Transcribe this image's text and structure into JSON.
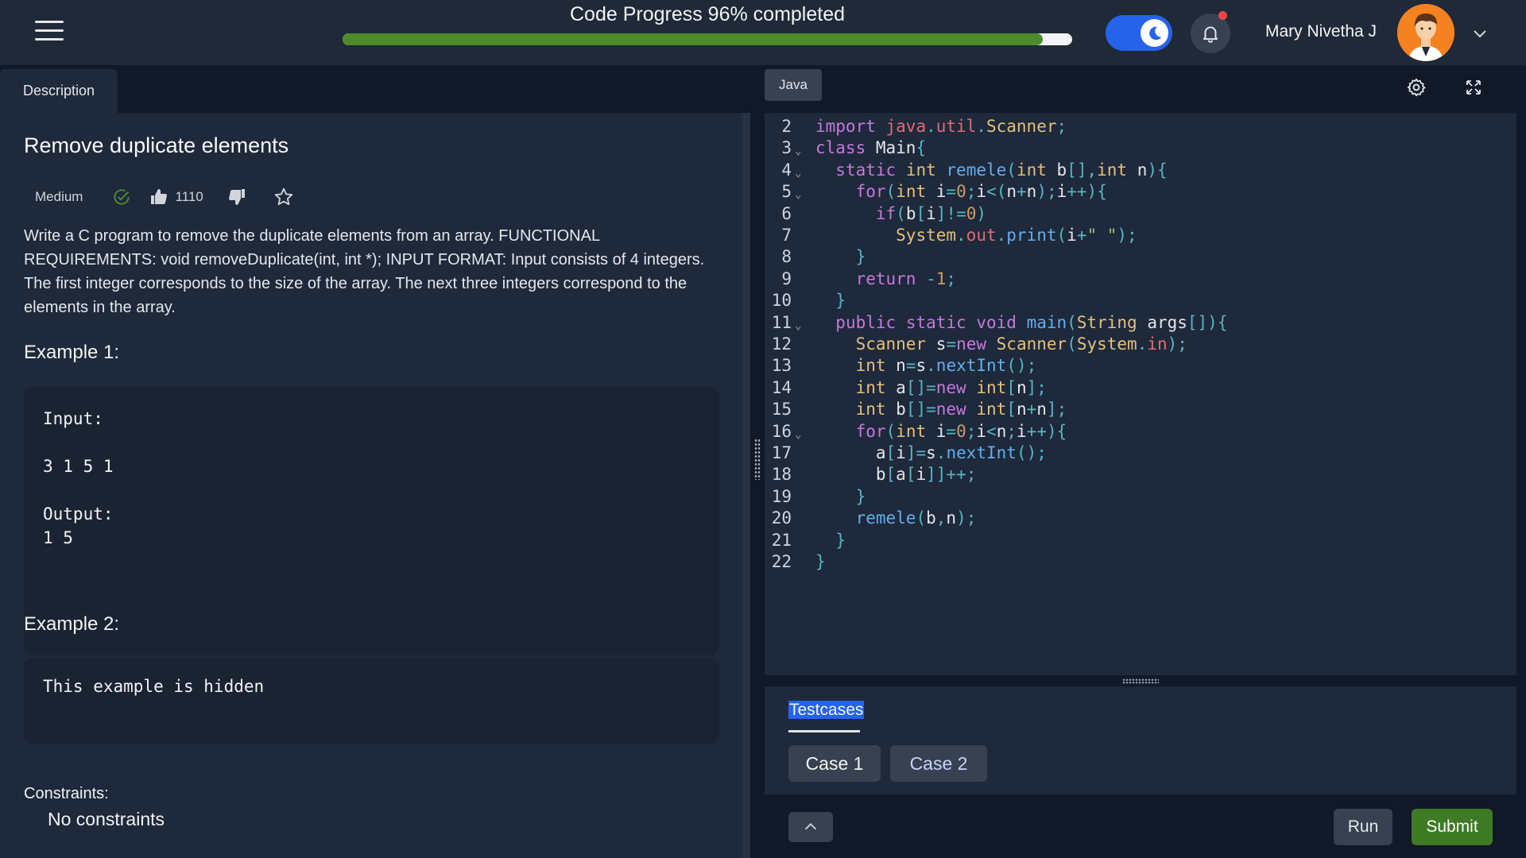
{
  "header": {
    "progress_label": "Code Progress 96% completed",
    "progress_fraction": 0.96,
    "user_name": "Mary Nivetha J",
    "theme_mode": "dark",
    "has_notification": true
  },
  "left_panel": {
    "tab_label": "Description",
    "problem_title": "Remove duplicate elements",
    "difficulty": "Medium",
    "likes": "1110",
    "description": "Write a C program to remove the duplicate elements from an array. FUNCTIONAL REQUIREMENTS: void removeDuplicate(int, int *); INPUT FORMAT: Input consists of 4 integers. The first integer corresponds to the size of the array. The next three integers correspond to the elements in the array.",
    "example1": {
      "title": "Example 1:",
      "input_label": "Input:",
      "input_value": "3 1 5 1",
      "output_label": "Output:",
      "output_value": "1 5"
    },
    "example2": {
      "title": "Example 2:",
      "text": "This example is hidden"
    },
    "constraints_label": "Constraints:",
    "constraints_value": "No constraints"
  },
  "editor": {
    "language": "Java",
    "lines": [
      {
        "n": "2",
        "fold": false,
        "code": "import java.util.Scanner;"
      },
      {
        "n": "3",
        "fold": true,
        "code": "class Main{"
      },
      {
        "n": "4",
        "fold": true,
        "code": "  static int remele(int b[],int n){"
      },
      {
        "n": "5",
        "fold": true,
        "code": "    for(int i=0;i<(n+n);i++){"
      },
      {
        "n": "6",
        "fold": false,
        "code": "      if(b[i]!=0)"
      },
      {
        "n": "7",
        "fold": false,
        "code": "        System.out.print(i+\" \");"
      },
      {
        "n": "8",
        "fold": false,
        "code": "    }"
      },
      {
        "n": "9",
        "fold": false,
        "code": "    return -1;"
      },
      {
        "n": "10",
        "fold": false,
        "code": "  }"
      },
      {
        "n": "11",
        "fold": true,
        "code": "  public static void main(String args[]){"
      },
      {
        "n": "12",
        "fold": false,
        "code": "    Scanner s=new Scanner(System.in);"
      },
      {
        "n": "13",
        "fold": false,
        "code": "    int n=s.nextInt();"
      },
      {
        "n": "14",
        "fold": false,
        "code": "    int a[]=new int[n];"
      },
      {
        "n": "15",
        "fold": false,
        "code": "    int b[]=new int[n+n];"
      },
      {
        "n": "16",
        "fold": true,
        "code": "    for(int i=0;i<n;i++){"
      },
      {
        "n": "17",
        "fold": false,
        "code": "      a[i]=s.nextInt();"
      },
      {
        "n": "18",
        "fold": false,
        "code": "      b[a[i]]++;"
      },
      {
        "n": "19",
        "fold": false,
        "code": "    }"
      },
      {
        "n": "20",
        "fold": false,
        "code": "    remele(b,n);"
      },
      {
        "n": "21",
        "fold": false,
        "code": "  }"
      },
      {
        "n": "22",
        "fold": false,
        "code": "}"
      }
    ]
  },
  "testcases": {
    "tab_label": "Testcases",
    "cases": [
      "Case 1",
      "Case 2"
    ]
  },
  "actions": {
    "run_label": "Run",
    "submit_label": "Submit"
  },
  "colors": {
    "accent": "#2563eb",
    "progress": "#4d8a2b",
    "submit": "#3f7a25",
    "notification": "#ef4444"
  }
}
